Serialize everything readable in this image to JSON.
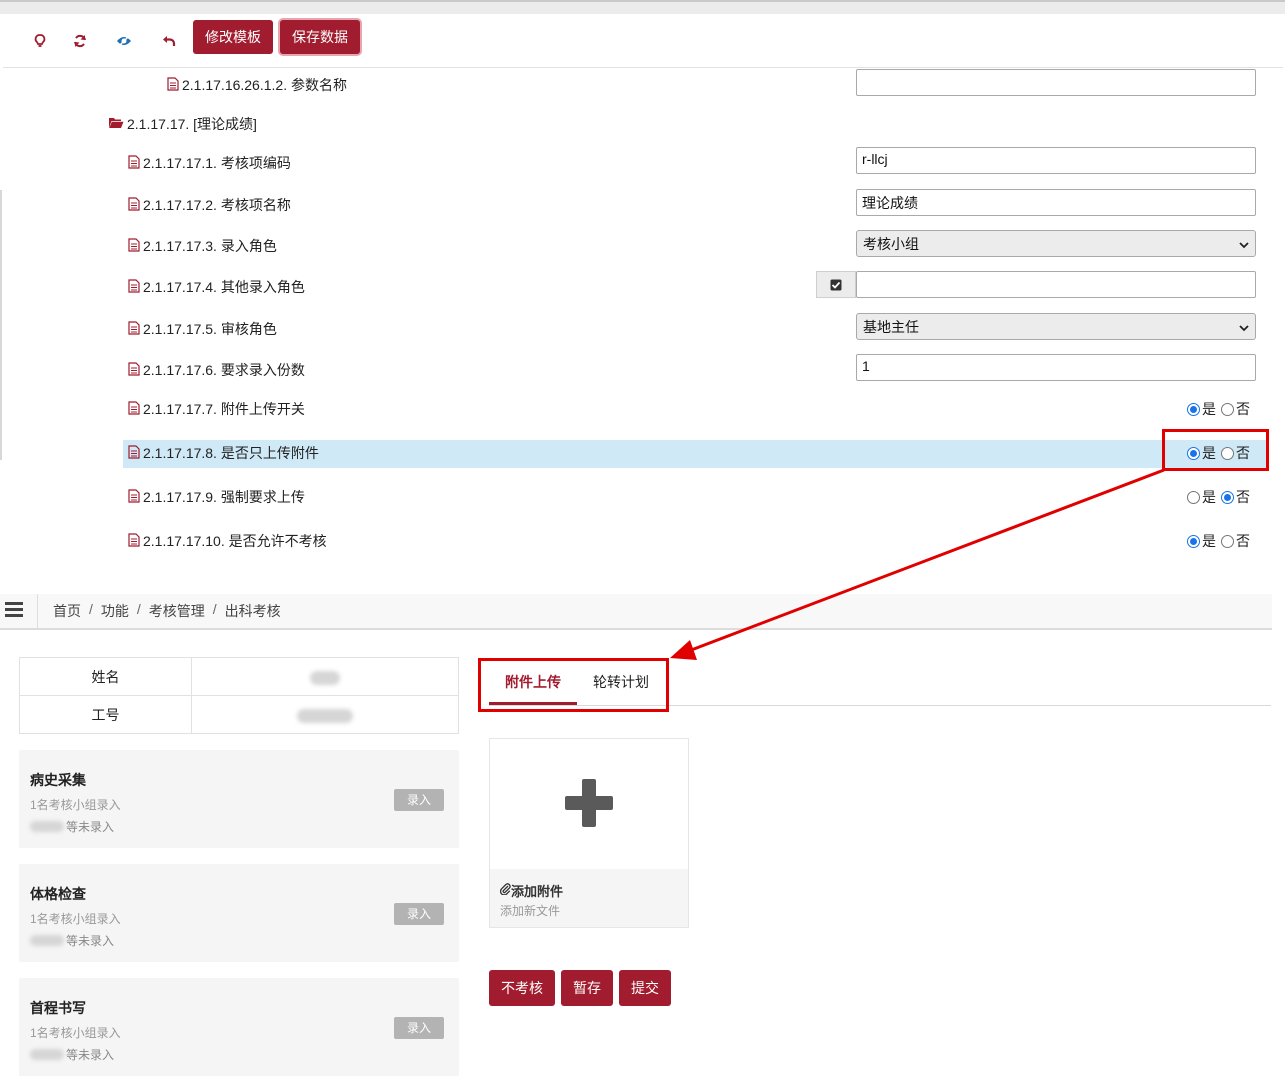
{
  "toolbar": {
    "icons": [
      "lightbulb-icon",
      "refresh-icon",
      "eye-icon",
      "undo-icon"
    ],
    "edit_template_label": "修改模板",
    "save_data_label": "保存数据"
  },
  "tree": {
    "rows": [
      {
        "label": "2.1.17.16.26.1.2. 参数名称",
        "type": "input",
        "value": ""
      },
      {
        "label": "2.1.17.17. [理论成绩]",
        "type": "folder"
      },
      {
        "label": "2.1.17.17.1. 考核项编码",
        "type": "input",
        "value": "r-llcj"
      },
      {
        "label": "2.1.17.17.2. 考核项名称",
        "type": "input",
        "value": "理论成绩"
      },
      {
        "label": "2.1.17.17.3. 录入角色",
        "type": "select",
        "value": "考核小组"
      },
      {
        "label": "2.1.17.17.4. 其他录入角色",
        "type": "checkbox-input",
        "value": ""
      },
      {
        "label": "2.1.17.17.5. 审核角色",
        "type": "select",
        "value": "基地主任"
      },
      {
        "label": "2.1.17.17.6. 要求录入份数",
        "type": "input",
        "value": "1"
      },
      {
        "label": "2.1.17.17.7. 附件上传开关",
        "type": "radio",
        "selected": "是"
      },
      {
        "label": "2.1.17.17.8. 是否只上传附件",
        "type": "radio",
        "selected": "是"
      },
      {
        "label": "2.1.17.17.9. 强制要求上传",
        "type": "radio",
        "selected": "否"
      },
      {
        "label": "2.1.17.17.10. 是否允许不考核",
        "type": "radio",
        "selected": "是"
      }
    ],
    "radio_yes": "是",
    "radio_no": "否"
  },
  "breadcrumb": {
    "items": [
      "首页",
      "功能",
      "考核管理",
      "出科考核"
    ],
    "separator": "/"
  },
  "info": {
    "name_label": "姓名",
    "id_label": "工号"
  },
  "cards": [
    {
      "title": "病史采集",
      "sub": "1名考核小组录入",
      "note": "等未录入",
      "button": "录入"
    },
    {
      "title": "体格检查",
      "sub": "1名考核小组录入",
      "note": "等未录入",
      "button": "录入"
    },
    {
      "title": "首程书写",
      "sub": "1名考核小组录入",
      "note": "等未录入",
      "button": "录入"
    }
  ],
  "tabs": [
    {
      "label": "附件上传",
      "active": true
    },
    {
      "label": "轮转计划",
      "active": false
    }
  ],
  "upload": {
    "title": "添加附件",
    "subtitle": "添加新文件"
  },
  "actions": {
    "skip_label": "不考核",
    "save_label": "暂存",
    "submit_label": "提交"
  },
  "colors": {
    "primary": "#a11c2e",
    "highlight_row": "#cfe9f7",
    "annotation": "#e00000",
    "radio_on": "#1a73e8"
  }
}
